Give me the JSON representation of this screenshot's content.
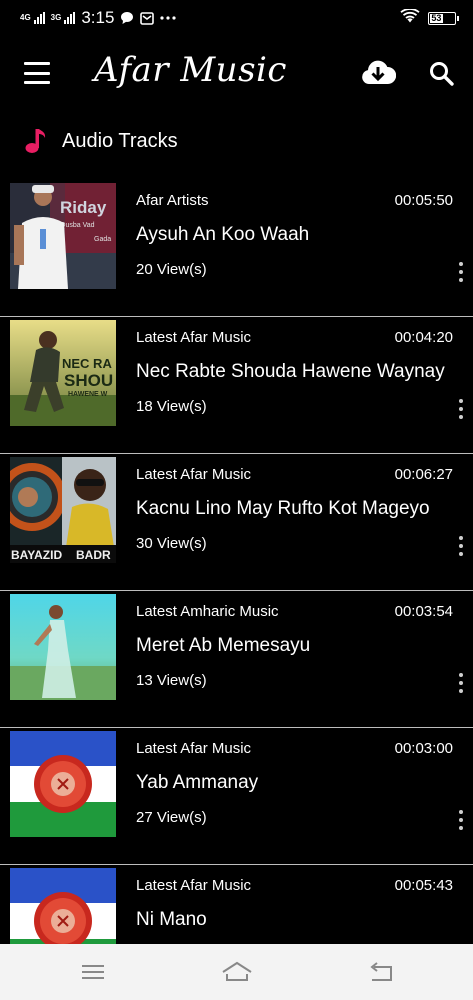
{
  "status_bar": {
    "network_1": "4G",
    "network_2": "3G",
    "time": "3:15",
    "battery": "53",
    "icons": [
      "signal-icon",
      "chat-bubble-icon",
      "mail-icon",
      "more-dots-icon",
      "wifi-icon",
      "battery-icon"
    ]
  },
  "app_bar": {
    "title": "Afar Music",
    "icons": [
      "hamburger-menu-icon",
      "cloud-download-icon",
      "search-icon"
    ]
  },
  "section": {
    "title": "Audio Tracks",
    "icon": "music-note-icon",
    "accent_color": "#e91e63"
  },
  "tracks": [
    {
      "category": "Afar Artists",
      "duration": "00:05:50",
      "title": "Aysuh An Koo Waah",
      "views": "20 View(s)"
    },
    {
      "category": "Latest Afar Music",
      "duration": "00:04:20",
      "title": "Nec Rabte Shouda Hawene Waynay",
      "views": "18 View(s)"
    },
    {
      "category": "Latest Afar Music",
      "duration": "00:06:27",
      "title": "Kacnu Lino May Rufto Kot Mageyo",
      "views": "30 View(s)"
    },
    {
      "category": "Latest Amharic Music",
      "duration": "00:03:54",
      "title": "Meret Ab Memesayu",
      "views": "13 View(s)"
    },
    {
      "category": "Latest Afar Music",
      "duration": "00:03:00",
      "title": "Yab Ammanay",
      "views": "27 View(s)"
    },
    {
      "category": "Latest Afar Music",
      "duration": "00:05:43",
      "title": "Ni Mano",
      "views": ""
    }
  ],
  "thumbnails": {
    "track_1_text_1": "Riday",
    "track_1_text_2": "Qusba Vad",
    "track_1_text_3": "Gada",
    "track_2_text_1": "NEC RA",
    "track_2_text_2": "SHOU",
    "track_2_text_3": "HAWENE W",
    "track_3_text_1": "BAYAZID",
    "track_3_text_2": "BADR"
  },
  "nav_bar": {
    "icons": [
      "recent-apps-icon",
      "home-icon",
      "back-icon"
    ]
  }
}
